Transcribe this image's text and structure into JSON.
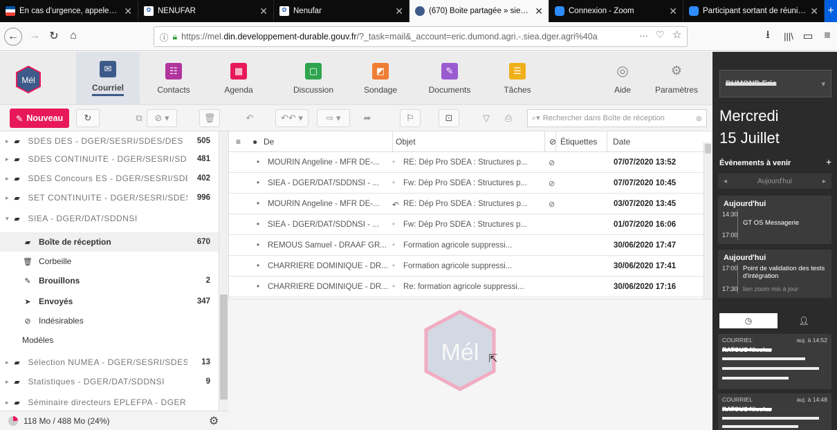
{
  "tabs": [
    {
      "title": "En cas d'urgence, appelez Past",
      "active": false
    },
    {
      "title": "NENUFAR",
      "active": false
    },
    {
      "title": "Nenufar",
      "active": false
    },
    {
      "title": "(670) Boite partagée » siea.dge",
      "active": true
    },
    {
      "title": "Connexion - Zoom",
      "active": false
    },
    {
      "title": "Participant sortant de réunion",
      "active": false
    }
  ],
  "url": {
    "prefix": "https://mel.",
    "domain": "din.developpement-durable.gouv.fr",
    "rest": "/?_task=mail&_account=eric.dumond.agri.-.siea.dger.agri%40a"
  },
  "apps": [
    {
      "label": "Courriel",
      "active": true
    },
    {
      "label": "Contacts"
    },
    {
      "label": "Agenda"
    },
    {
      "label": "Discussion"
    },
    {
      "label": "Sondage"
    },
    {
      "label": "Documents"
    },
    {
      "label": "Tâches"
    },
    {
      "label": "Aide"
    },
    {
      "label": "Paramètres"
    }
  ],
  "toolbar": {
    "new_label": "Nouveau",
    "search_placeholder": "Rechercher dans Boîte de réception"
  },
  "folders": [
    {
      "name": "SDES DES - DGER/SESRI/SDES/DES",
      "count": "505",
      "blurred": true
    },
    {
      "name": "SDES CONTINUITE - DGER/SESRI/SDES",
      "count": "481",
      "blurred": true
    },
    {
      "name": "SDES Concours ES - DGER/SESRI/SDES/DES",
      "count": "402",
      "blurred": true
    },
    {
      "name": "SET CONTINUITE - DGER/SESRI/SDES",
      "count": "996",
      "blurred": true
    },
    {
      "name": "SIEA - DGER/DAT/SDDNSI",
      "count": "",
      "blurred": true
    },
    {
      "name": "Boîte de réception",
      "count": "670",
      "selected": true
    },
    {
      "name": "Corbeille",
      "count": ""
    },
    {
      "name": "Brouillons",
      "count": "2"
    },
    {
      "name": "Envoyés",
      "count": "347"
    },
    {
      "name": "Indésirables",
      "count": ""
    },
    {
      "name": "Modèles",
      "count": ""
    },
    {
      "name": "Sélection NUMEA - DGER/SESRI/SDES/SDPOFE",
      "count": "13",
      "blurred": true
    },
    {
      "name": "Statistiques - DGER/DAT/SDDNSI",
      "count": "9",
      "blurred": true
    },
    {
      "name": "Séminaire directeurs EPLEFPA - DGER",
      "count": "",
      "blurred": true
    }
  ],
  "quota": "118 Mo / 488 Mo (24%)",
  "list_headers": {
    "from": "De",
    "subject": "Objet",
    "labels": "Étiquettes",
    "date": "Date"
  },
  "messages": [
    {
      "from": "MOURIN Angeline - MFR DE-...",
      "subject": "RE: Dép Pro SDEA : Structures p...",
      "date": "07/07/2020 13:52"
    },
    {
      "from": "SIEA - DGER/DAT/SDDNSI - ...",
      "subject": "Fw: Dép Pro SDEA : Structures p...",
      "date": "07/07/2020 10:45"
    },
    {
      "from": "MOURIN Angeline - MFR DE-...",
      "subject": "RE: Dép Pro SDEA : Structures p...",
      "date": "03/07/2020 13:45"
    },
    {
      "from": "SIEA - DGER/DAT/SDDNSI - ...",
      "subject": "Fw: Dép Pro SDEA : Structures p...",
      "date": "01/07/2020 16:06"
    },
    {
      "from": "REMOUS Samuel - DRAAF GR...",
      "subject": "Formation agricole suppressi...",
      "date": "30/06/2020 17:47"
    },
    {
      "from": "CHARRIERE DOMINIQUE - DR...",
      "subject": "Formation agricole suppressi...",
      "date": "30/06/2020 17:41"
    },
    {
      "from": "CHARRIERE DOMINIQUE - DR...",
      "subject": "Re: formation agricole suppressi...",
      "date": "30/06/2020 17:16"
    }
  ],
  "logo_text": "Mél",
  "calendar": {
    "account": "DUMOND Eric",
    "day": "Mercredi",
    "date": "15 Juillet",
    "upcoming_label": "Évènements à venir",
    "nav_label": "Aujourd'hui",
    "events": [
      {
        "header": "Aujourd'hui",
        "start": "14:30",
        "end": "17:00",
        "title": "GT OS Messagerie"
      },
      {
        "header": "Aujourd'hui",
        "start": "17:00",
        "end": "17:30",
        "title": "Point de validation des tests d'intégration",
        "sub": "lien zoom mis à jour"
      }
    ],
    "mail_items": [
      {
        "kind": "COURRIEL",
        "time": "auj. à 14:52",
        "from": "RATOUS Nicolas"
      },
      {
        "kind": "COURRIEL",
        "time": "auj. à 14:48",
        "from": "RATOUS Nicolas"
      }
    ]
  }
}
